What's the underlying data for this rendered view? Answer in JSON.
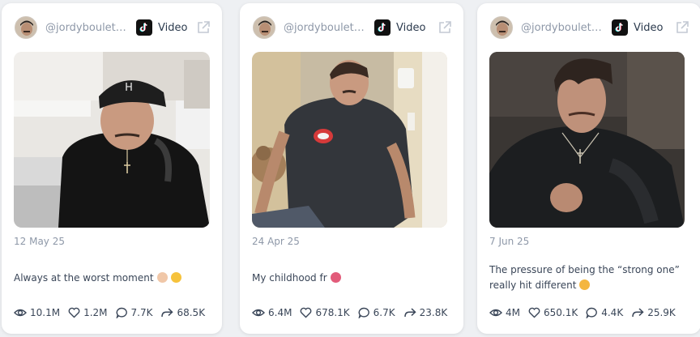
{
  "cards": [
    {
      "handle": "@jordybouletvi...",
      "platform_label": "Video",
      "date": "12 May 25",
      "caption": "Always at the worst moment",
      "stats": {
        "views": "10.1M",
        "likes": "1.2M",
        "comments": "7.7K",
        "shares": "68.5K"
      }
    },
    {
      "handle": "@jordybouletvi...",
      "platform_label": "Video",
      "date": "24 Apr 25",
      "caption": "My childhood fr",
      "stats": {
        "views": "6.4M",
        "likes": "678.1K",
        "comments": "6.7K",
        "shares": "23.8K"
      }
    },
    {
      "handle": "@jordybouletvi...",
      "platform_label": "Video",
      "date": "7 Jun 25",
      "caption": "The pressure of being the “strong one” really hit different",
      "stats": {
        "views": "4M",
        "likes": "650.1K",
        "comments": "4.4K",
        "shares": "25.9K"
      }
    }
  ],
  "icons": {
    "platform": "tiktok-icon",
    "external": "external-link-icon",
    "views": "eye-icon",
    "likes": "heart-icon",
    "comments": "comment-icon",
    "shares": "share-icon"
  },
  "colors": {
    "muted": "#8e98a8",
    "text": "#3a4658",
    "card": "#ffffff",
    "background": "#eef0f3"
  }
}
